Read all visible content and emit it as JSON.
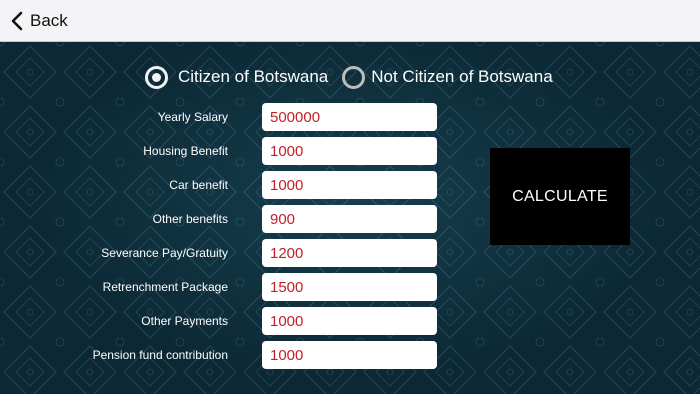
{
  "nav": {
    "back_label": "Back"
  },
  "citizenship": {
    "options": [
      {
        "label": "Citizen of Botswana",
        "selected": true
      },
      {
        "label": "Not Citizen of Botswana",
        "selected": false
      }
    ]
  },
  "fields": [
    {
      "label": "Yearly Salary",
      "value": "500000"
    },
    {
      "label": "Housing Benefit",
      "value": "1000"
    },
    {
      "label": "Car benefit",
      "value": "1000"
    },
    {
      "label": "Other benefits",
      "value": "900"
    },
    {
      "label": "Severance Pay/Gratuity",
      "value": "1200"
    },
    {
      "label": "Retrenchment Package",
      "value": "1500"
    },
    {
      "label": "Other Payments",
      "value": "1000"
    },
    {
      "label": "Pension fund  contribution",
      "value": "1000"
    }
  ],
  "calculate_label": "CALCULATE",
  "colors": {
    "background": "#0c2835",
    "input_text": "#c0202a",
    "button_bg": "#000000"
  }
}
